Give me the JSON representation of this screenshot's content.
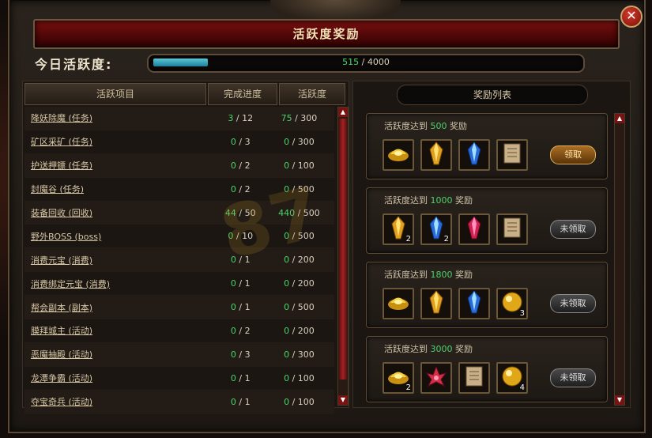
{
  "window": {
    "title": "活跃度奖励"
  },
  "activity": {
    "label": "今日活跃度:",
    "current": "515",
    "sep": " / ",
    "max": "4000",
    "fraction": 0.129
  },
  "left_panel": {
    "headers": {
      "item": "活跃项目",
      "progress": "完成进度",
      "score": "活跃度"
    },
    "rows": [
      {
        "name": "降妖除魔 (任务)",
        "prog_done": "3",
        "prog_total": " / 12",
        "score_done": "75",
        "score_total": " / 300"
      },
      {
        "name": "矿区采矿 (任务)",
        "prog_done": "0",
        "prog_total": " / 3",
        "score_done": "0",
        "score_total": " / 300"
      },
      {
        "name": "护送押镖 (任务)",
        "prog_done": "0",
        "prog_total": " / 2",
        "score_done": "0",
        "score_total": " / 100"
      },
      {
        "name": "封魔谷 (任务)",
        "prog_done": "0",
        "prog_total": " / 2",
        "score_done": "0",
        "score_total": " / 500"
      },
      {
        "name": "装备回收 (回收)",
        "prog_done": "44",
        "prog_total": " / 50",
        "score_done": "440",
        "score_total": " / 500"
      },
      {
        "name": "野外BOSS (boss)",
        "prog_done": "0",
        "prog_total": " / 10",
        "score_done": "0",
        "score_total": " / 500"
      },
      {
        "name": "消费元宝 (消费)",
        "prog_done": "0",
        "prog_total": " / 1",
        "score_done": "0",
        "score_total": " / 200"
      },
      {
        "name": "消费绑定元宝 (消费)",
        "prog_done": "0",
        "prog_total": " / 1",
        "score_done": "0",
        "score_total": " / 200"
      },
      {
        "name": "帮会副本 (副本)",
        "prog_done": "0",
        "prog_total": " / 1",
        "score_done": "0",
        "score_total": " / 500"
      },
      {
        "name": "膜拜城主 (活动)",
        "prog_done": "0",
        "prog_total": " / 2",
        "score_done": "0",
        "score_total": " / 200"
      },
      {
        "name": "恶魔抽殿 (活动)",
        "prog_done": "0",
        "prog_total": " / 3",
        "score_done": "0",
        "score_total": " / 300"
      },
      {
        "name": "龙潭争霸 (活动)",
        "prog_done": "0",
        "prog_total": " / 1",
        "score_done": "0",
        "score_total": " / 100"
      },
      {
        "name": "夺宝奇兵 (活动)",
        "prog_done": "0",
        "prog_total": " / 1",
        "score_done": "0",
        "score_total": " / 100"
      }
    ]
  },
  "right_panel": {
    "header": "奖励列表",
    "rewards": [
      {
        "prefix": "活跃度达到 ",
        "threshold": "500",
        "suffix": " 奖励",
        "button": "领取",
        "claimable": true,
        "items": [
          {
            "icon": "gold-ingot-icon",
            "count": ""
          },
          {
            "icon": "yellow-crystal-icon",
            "count": ""
          },
          {
            "icon": "blue-crystal-icon",
            "count": ""
          },
          {
            "icon": "scroll-icon",
            "count": ""
          }
        ]
      },
      {
        "prefix": "活跃度达到 ",
        "threshold": "1000",
        "suffix": " 奖励",
        "button": "未领取",
        "claimable": false,
        "items": [
          {
            "icon": "yellow-crystal-icon",
            "count": "2"
          },
          {
            "icon": "blue-crystal-icon",
            "count": "2"
          },
          {
            "icon": "red-crystal-icon",
            "count": ""
          },
          {
            "icon": "scroll-icon",
            "count": ""
          }
        ]
      },
      {
        "prefix": "活跃度达到 ",
        "threshold": "1800",
        "suffix": " 奖励",
        "button": "未领取",
        "claimable": false,
        "items": [
          {
            "icon": "gold-ingot-icon",
            "count": ""
          },
          {
            "icon": "yellow-crystal-icon",
            "count": ""
          },
          {
            "icon": "blue-crystal-icon",
            "count": ""
          },
          {
            "icon": "gold-orb-icon",
            "count": "3"
          }
        ]
      },
      {
        "prefix": "活跃度达到 ",
        "threshold": "3000",
        "suffix": " 奖励",
        "button": "未领取",
        "claimable": false,
        "items": [
          {
            "icon": "gold-ingot-icon",
            "count": "2"
          },
          {
            "icon": "red-flower-icon",
            "count": ""
          },
          {
            "icon": "scroll-icon",
            "count": ""
          },
          {
            "icon": "gold-orb-icon",
            "count": "4"
          }
        ]
      }
    ]
  },
  "colors": {
    "green": "#4cd26a",
    "title_red": "#7a1010",
    "gold_border": "#6a5638"
  }
}
